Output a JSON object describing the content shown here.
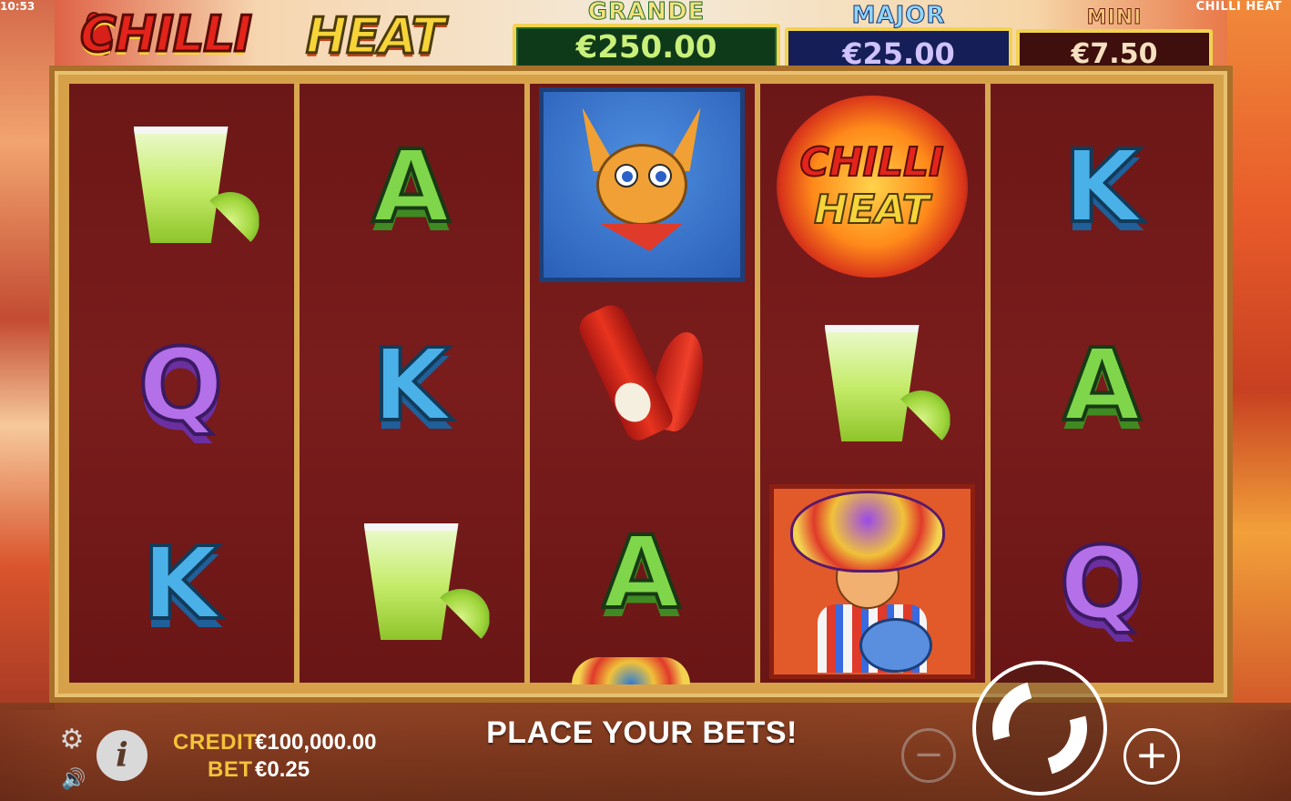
{
  "status": {
    "clock": "10:53",
    "corner_title": "CHILLI HEAT"
  },
  "logo": {
    "word1": "CHILLI",
    "word2": "HEAT"
  },
  "jackpots": {
    "grande": {
      "label": "GRANDE",
      "amount": "€250.00"
    },
    "major": {
      "label": "MAJOR",
      "amount": "€25.00"
    },
    "mini": {
      "label": "MINI",
      "amount": "€7.50"
    }
  },
  "reels": [
    [
      "tequila-shot",
      "Q",
      "K"
    ],
    [
      "A",
      "K",
      "tequila-shot"
    ],
    [
      "chihuahua",
      "hot-sauce",
      "A"
    ],
    [
      "chilli-heat-logo",
      "tequila-shot",
      "mariachi"
    ],
    [
      "K",
      "A",
      "Q"
    ]
  ],
  "symbol_text": {
    "a": "A",
    "k": "K",
    "q": "Q",
    "logo_word1": "CHILLI",
    "logo_word2": "HEAT"
  },
  "bottom": {
    "credit_label": "CREDIT",
    "credit_value": "€100,000.00",
    "bet_label": "BET",
    "bet_value": "€0.25",
    "message": "PLACE YOUR BETS!",
    "info_label": "i",
    "minus_label": "−",
    "plus_label": "+"
  },
  "icons": {
    "settings": "gear-icon",
    "sound": "speaker-icon",
    "info": "info-icon",
    "spin": "spin-arrows-icon"
  }
}
